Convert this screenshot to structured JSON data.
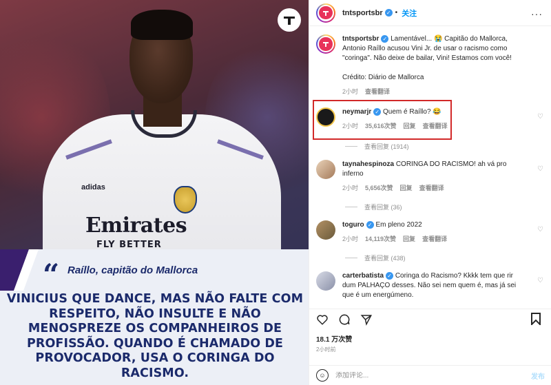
{
  "header": {
    "username": "tntsportsbr",
    "follow_label": "关注",
    "more_label": "···"
  },
  "image": {
    "shirt_brand": "Emirates",
    "shirt_sub": "FLY BETTER",
    "shirt_logo": "adidas",
    "quote_author": "Raíllo, capitão do Mallorca",
    "quote_mark": "“",
    "quote_text": "VINICIUS QUE DANCE, MAS NÃO FALTE COM RESPEITO, NÃO INSULTE E NÃO MENOSPREZE OS COMPANHEIROS DE PROFISSÃO. QUANDO É CHAMADO DE PROVOCADOR, USA O CORINGA DO RACISMO."
  },
  "caption": {
    "username": "tntsportsbr",
    "text": "Lamentável... 😭 Capitão do Mallorca, Antonio Raíllo acusou Vini Jr. de usar o racismo como \"coringa\". Não deixe de bailar, Vini! Estamos com você!",
    "credit": "Crédito: Diário de Mallorca",
    "time": "2小时",
    "translate": "查看翻译"
  },
  "comments": [
    {
      "username": "neymarjr",
      "verified": true,
      "text": "Quem é Raíllo? 😂",
      "time": "2小时",
      "likes": "35,616次赞",
      "reply": "回复",
      "translate": "查看翻译",
      "view_replies": "查看回复 (1914)"
    },
    {
      "username": "taynahespinoza",
      "verified": false,
      "text": "CORINGA DO RACISMO! ah vá pro inferno",
      "time": "2小时",
      "likes": "5,656次赞",
      "reply": "回复",
      "translate": "查看翻译",
      "view_replies": "查看回复 (36)"
    },
    {
      "username": "toguro",
      "verified": true,
      "text": "Em pleno 2022",
      "time": "2小时",
      "likes": "14,119次赞",
      "reply": "回复",
      "translate": "查看翻译",
      "view_replies": "查看回复 (438)"
    },
    {
      "username": "carterbatista",
      "verified": true,
      "text": "Coringa do Racismo? Kkkk tem que rir dum PALHAÇO desses. Não sei nem quem é, mas já sei que é um energúmeno."
    }
  ],
  "footer": {
    "likes": "18.1 万次赞",
    "time": "2小时前",
    "comment_placeholder": "添加评论...",
    "post_label": "发布"
  },
  "colors": {
    "accent": "#0095f6",
    "highlight": "#d22828",
    "quote": "#1b2a6b"
  }
}
